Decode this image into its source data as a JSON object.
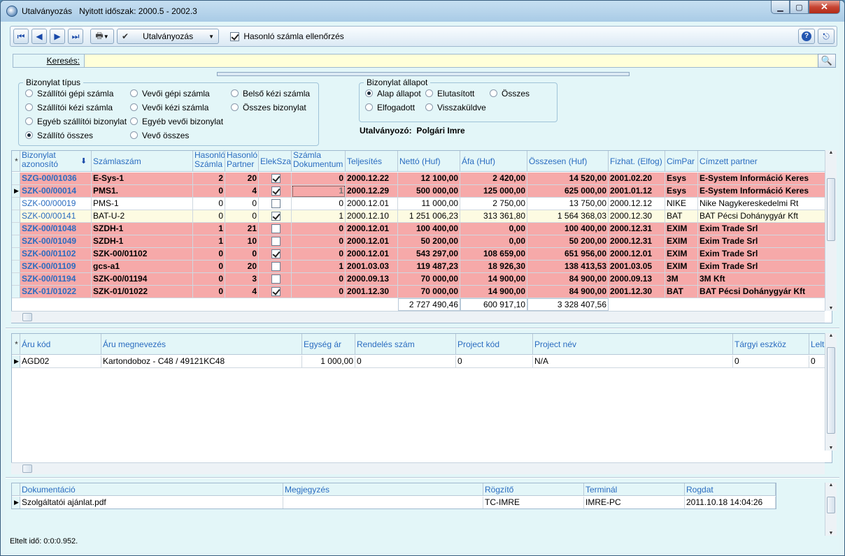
{
  "window": {
    "title": "Utalványozás",
    "period_label": "Nyitott időszak: 2000.5 - 2002.3"
  },
  "toolbar": {
    "action_label": "Utalványozás",
    "similar_check_label": "Hasonló számla ellenőrzés",
    "similar_checked": true
  },
  "search": {
    "label": "Keresés:",
    "value": ""
  },
  "doc_type": {
    "legend": "Bizonylat típus",
    "options": [
      {
        "label": "Szállítói gépi számla",
        "selected": false
      },
      {
        "label": "Vevői gépi számla",
        "selected": false
      },
      {
        "label": "Belső kézi számla",
        "selected": false
      },
      {
        "label": "Szállítói kézi számla",
        "selected": false
      },
      {
        "label": "Vevői kézi számla",
        "selected": false
      },
      {
        "label": "Összes bizonylat",
        "selected": false
      },
      {
        "label": "Egyéb szállítói bizonylat",
        "selected": false
      },
      {
        "label": "Egyéb vevői bizonylat",
        "selected": false
      },
      {
        "label": "Szállító összes",
        "selected": true
      },
      {
        "label": "Vevő összes",
        "selected": false
      }
    ]
  },
  "doc_state": {
    "legend": "Bizonylat állapot",
    "options": [
      {
        "label": "Alap állapot",
        "selected": true
      },
      {
        "label": "Elutasított",
        "selected": false
      },
      {
        "label": "Összes",
        "selected": false
      },
      {
        "label": "Elfogadott",
        "selected": false
      },
      {
        "label": "Visszaküldve",
        "selected": false
      }
    ]
  },
  "approver": {
    "label": "Utalványozó:",
    "name": "Polgári Imre"
  },
  "main_grid": {
    "columns": [
      "Bizonylat azonosító",
      "Számlaszám",
      "Hasonló Számla",
      "Hasonló Partner",
      "ElekSzal",
      "Számla Dokumentum",
      "Teljesítés",
      "Nettó (Huf)",
      "Áfa (Huf)",
      "Összesen (Huf)",
      "Fizhat. (Elfog)",
      "CimPar",
      "Címzett partner"
    ],
    "rows": [
      {
        "id": "SZG-00/01036",
        "szamla": "E-Sys-1",
        "hs": "2",
        "hp": "20",
        "elek": true,
        "dok": "0",
        "telj": "2000.12.22",
        "netto": "12 100,00",
        "afa": "2 420,00",
        "ossz": "14 520,00",
        "fiz": "2001.02.20",
        "cim": "Esys",
        "partner": "E-System Információ Keres",
        "color": "#f6a9a9",
        "bold": true,
        "current": false
      },
      {
        "id": "SZK-00/00014",
        "szamla": "PMS1.",
        "hs": "0",
        "hp": "4",
        "elek": true,
        "dok": "1",
        "telj": "2000.12.29",
        "netto": "500 000,00",
        "afa": "125 000,00",
        "ossz": "625 000,00",
        "fiz": "2001.01.12",
        "cim": "Esys",
        "partner": "E-System Információ Keres",
        "color": "#f6a9a9",
        "bold": true,
        "current": true
      },
      {
        "id": "SZK-00/00019",
        "szamla": "PMS-1",
        "hs": "0",
        "hp": "0",
        "elek": false,
        "dok": "0",
        "telj": "2000.12.01",
        "netto": "11 000,00",
        "afa": "2 750,00",
        "ossz": "13 750,00",
        "fiz": "2000.12.12",
        "cim": "NIKE",
        "partner": "Nike Nagykereskedelmi Rt",
        "color": "#ffffff",
        "bold": false,
        "current": false
      },
      {
        "id": "SZK-00/00141",
        "szamla": "BAT-U-2",
        "hs": "0",
        "hp": "0",
        "elek": true,
        "dok": "1",
        "telj": "2000.12.10",
        "netto": "1 251 006,23",
        "afa": "313 361,80",
        "ossz": "1 564 368,03",
        "fiz": "2000.12.30",
        "cim": "BAT",
        "partner": "BAT Pécsi Dohánygyár Kft",
        "color": "#fdfbe2",
        "bold": false,
        "current": false
      },
      {
        "id": "SZK-00/01048",
        "szamla": "SZDH-1",
        "hs": "1",
        "hp": "21",
        "elek": false,
        "dok": "0",
        "telj": "2000.12.01",
        "netto": "100 400,00",
        "afa": "0,00",
        "ossz": "100 400,00",
        "fiz": "2000.12.31",
        "cim": "EXIM",
        "partner": "Exim Trade Srl",
        "color": "#f6a9a9",
        "bold": true,
        "current": false
      },
      {
        "id": "SZK-00/01049",
        "szamla": "SZDH-1",
        "hs": "1",
        "hp": "10",
        "elek": false,
        "dok": "0",
        "telj": "2000.12.01",
        "netto": "50 200,00",
        "afa": "0,00",
        "ossz": "50 200,00",
        "fiz": "2000.12.31",
        "cim": "EXIM",
        "partner": "Exim Trade Srl",
        "color": "#f6a9a9",
        "bold": true,
        "current": false
      },
      {
        "id": "SZK-00/01102",
        "szamla": "SZK-00/01102",
        "hs": "0",
        "hp": "0",
        "elek": true,
        "dok": "0",
        "telj": "2000.12.01",
        "netto": "543 297,00",
        "afa": "108 659,00",
        "ossz": "651 956,00",
        "fiz": "2000.12.01",
        "cim": "EXIM",
        "partner": "Exim Trade Srl",
        "color": "#f6a9a9",
        "bold": true,
        "current": false
      },
      {
        "id": "SZK-00/01109",
        "szamla": "gcs-a1",
        "hs": "0",
        "hp": "20",
        "elek": false,
        "dok": "1",
        "telj": "2001.03.03",
        "netto": "119 487,23",
        "afa": "18 926,30",
        "ossz": "138 413,53",
        "fiz": "2001.03.05",
        "cim": "EXIM",
        "partner": "Exim Trade Srl",
        "color": "#f6a9a9",
        "bold": true,
        "current": false
      },
      {
        "id": "SZK-00/01194",
        "szamla": "SZK-00/01194",
        "hs": "0",
        "hp": "3",
        "elek": false,
        "dok": "0",
        "telj": "2000.09.13",
        "netto": "70 000,00",
        "afa": "14 900,00",
        "ossz": "84 900,00",
        "fiz": "2000.09.13",
        "cim": "3M",
        "partner": "3M Kft",
        "color": "#f6a9a9",
        "bold": true,
        "current": false
      },
      {
        "id": "SZK-01/01022",
        "szamla": "SZK-01/01022",
        "hs": "0",
        "hp": "4",
        "elek": true,
        "dok": "0",
        "telj": "2001.12.30",
        "netto": "70 000,00",
        "afa": "14 900,00",
        "ossz": "84 900,00",
        "fiz": "2001.12.30",
        "cim": "BAT",
        "partner": "BAT Pécsi Dohánygyár Kft",
        "color": "#f6a9a9",
        "bold": true,
        "current": false
      }
    ],
    "totals": {
      "netto": "2 727 490,46",
      "afa": "600 917,10",
      "ossz": "3 328 407,56"
    }
  },
  "item_grid": {
    "columns": [
      "Áru kód",
      "Áru megnevezés",
      "Egység ár",
      "Rendelés szám",
      "Project kód",
      "Project név",
      "Tárgyi eszköz",
      "Leltá"
    ],
    "rows": [
      {
        "kod": "AGD02",
        "nev": "Kartondoboz - C48 / 49121KC48",
        "ar": "1 000,00",
        "rend": "0",
        "pkod": "0",
        "pnev": "N/A",
        "targy": "0",
        "lelt": "0"
      }
    ]
  },
  "doc_grid": {
    "columns": [
      "Dokumentáció",
      "Megjegyzés",
      "Rögzítő",
      "Terminál",
      "Rogdat"
    ],
    "rows": [
      {
        "dok": "Szolgáltatói ajánlat.pdf",
        "megj": "",
        "rogz": "TC-IMRE",
        "term": "IMRE-PC",
        "dat": "2011.10.18 14:04:26"
      }
    ]
  },
  "status": {
    "elapsed": "Eltelt idő: 0:0:0.952."
  },
  "colors": {
    "highlight_row": "#f6a9a9",
    "link_blue": "#2a6cc0",
    "panel_bg": "#e3f6f8"
  }
}
